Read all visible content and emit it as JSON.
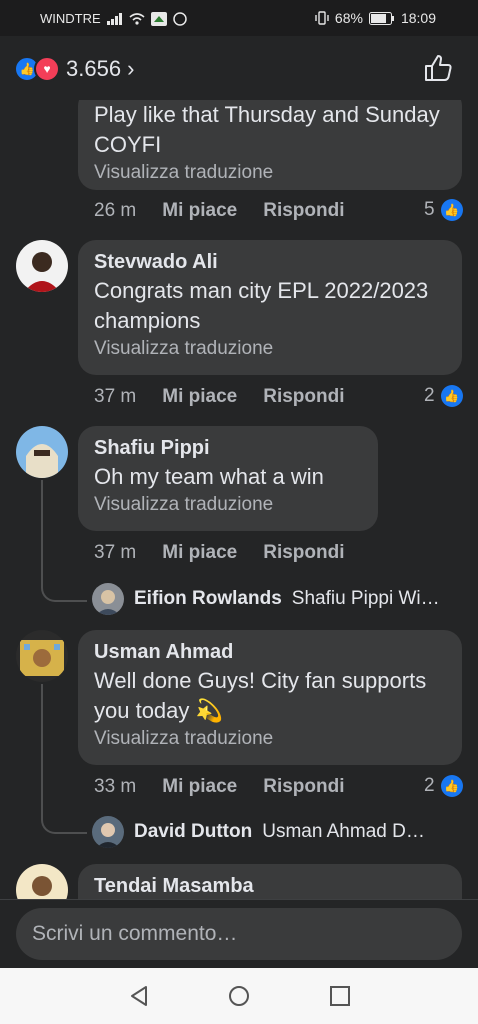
{
  "status_bar": {
    "carrier": "WINDTRE",
    "battery": "68%",
    "time": "18:09"
  },
  "header": {
    "reaction_count": "3.656",
    "chevron": "›"
  },
  "comments": [
    {
      "text": "Play like that Thursday and Sunday COYFI",
      "translate": "Visualizza traduzione",
      "time": "26 m",
      "like": "Mi piace",
      "reply": "Rispondi",
      "likes": "5"
    },
    {
      "author": "Stevwado Ali",
      "text": "Congrats man city EPL 2022/2023 champions",
      "translate": "Visualizza traduzione",
      "time": "37 m",
      "like": "Mi piace",
      "reply": "Rispondi",
      "likes": "2"
    },
    {
      "author": "Shafiu Pippi",
      "text": "Oh my team what a win",
      "translate": "Visualizza traduzione",
      "time": "37 m",
      "like": "Mi piace",
      "reply": "Rispondi",
      "reply_preview": {
        "author": "Eifion Rowlands",
        "text": "Shafiu Pippi Wi…"
      }
    },
    {
      "author": "Usman Ahmad",
      "text": "Well done Guys! City fan supports you today",
      "emoji": "💫",
      "translate": "Visualizza traduzione",
      "time": "33 m",
      "like": "Mi piace",
      "reply": "Rispondi",
      "likes": "2",
      "reply_preview": {
        "author": "David Dutton",
        "text": "Usman Ahmad Do…"
      }
    },
    {
      "author": "Tendai Masamba"
    }
  ],
  "composer": {
    "placeholder": "Scrivi un commento…"
  },
  "colors": {
    "background": "#242526",
    "bubble": "#3a3b3c",
    "accent": "#1877f2",
    "love": "#f33e58",
    "muted": "#b0b3b8"
  }
}
